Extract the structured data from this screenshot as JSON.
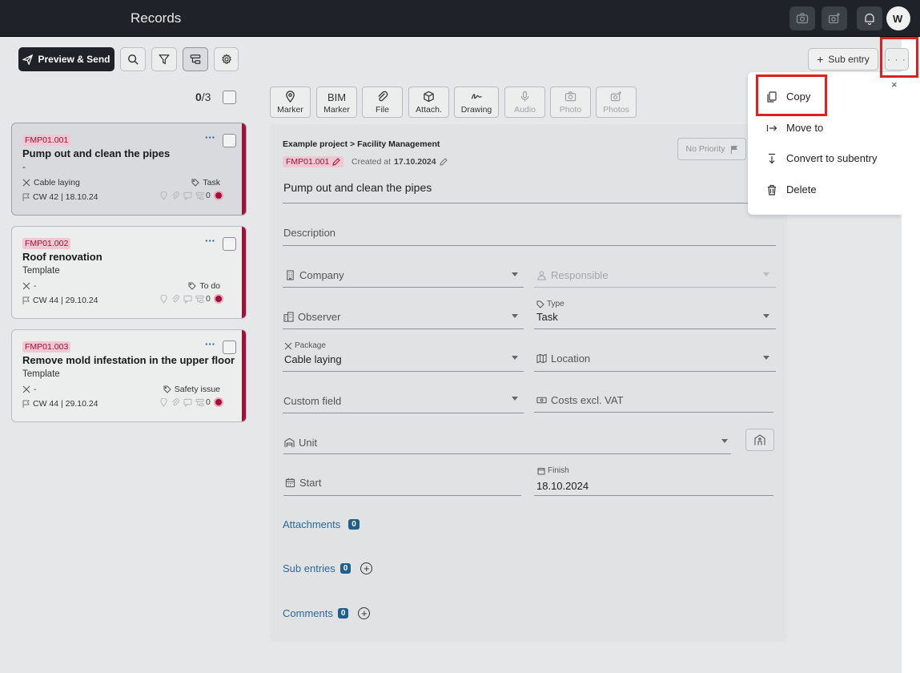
{
  "header": {
    "title": "Records",
    "avatar": "W"
  },
  "toolbar": {
    "preview_send": "Preview & Send",
    "sub_entry": "Sub entry",
    "more": "· · ·"
  },
  "list": {
    "counter_selected": "0",
    "counter_total": "/3",
    "cards": [
      {
        "id": "FMP01.001",
        "title": "Pump out and clean the pipes",
        "sub": "-",
        "package": "Cable laying",
        "tag": "Task",
        "cw": "CW 42 | 18.10.24",
        "count": "0"
      },
      {
        "id": "FMP01.002",
        "title": "Roof renovation",
        "sub": "Template",
        "package": "-",
        "tag": "To do",
        "cw": "CW 44 | 29.10.24",
        "count": "0"
      },
      {
        "id": "FMP01.003",
        "title": "Remove mold infestation in the upper floor",
        "sub": "Template",
        "package": "-",
        "tag": "Safety issue",
        "cw": "CW 44 | 29.10.24",
        "count": "0"
      }
    ]
  },
  "tools": [
    {
      "label": "Marker",
      "icon": "map-pin-icon"
    },
    {
      "label": "Marker",
      "top": "BIM"
    },
    {
      "label": "File",
      "icon": "paperclip-icon"
    },
    {
      "label": "Attach.",
      "icon": "cube-icon"
    },
    {
      "label": "Drawing",
      "icon": "signature-icon"
    },
    {
      "label": "Audio",
      "icon": "microphone-icon"
    },
    {
      "label": "Photo",
      "icon": "camera-icon"
    },
    {
      "label": "Photos",
      "icon": "camera-plus-icon"
    }
  ],
  "detail": {
    "breadcrumb": "Example project > Facility Management",
    "id": "FMP01.001",
    "created_label": "Created at",
    "created_date": "17.10.2024",
    "priority": "No Priority",
    "title": "Pump out and clean the pipes",
    "description_placeholder": "Description",
    "company": "Company",
    "responsible": "Responsible",
    "observer": "Observer",
    "type_label": "Type",
    "type_value": "Task",
    "package_label": "Package",
    "package_value": "Cable laying",
    "location": "Location",
    "custom_field": "Custom field",
    "costs": "Costs excl. VAT",
    "unit": "Unit",
    "start": "Start",
    "finish_label": "Finish",
    "finish_value": "18.10.2024",
    "attachments": "Attachments",
    "attachments_count": "0",
    "sub_entries": "Sub entries",
    "sub_entries_count": "0",
    "comments": "Comments",
    "comments_count": "0"
  },
  "menu": {
    "close": "×",
    "items": [
      "Copy",
      "Move to",
      "Convert to subentry",
      "Delete"
    ]
  },
  "colors": {
    "brand_dark": "#1f2228",
    "accent_red": "#a0103a",
    "link_blue": "#2a6a9a",
    "highlight": "#e02020"
  }
}
